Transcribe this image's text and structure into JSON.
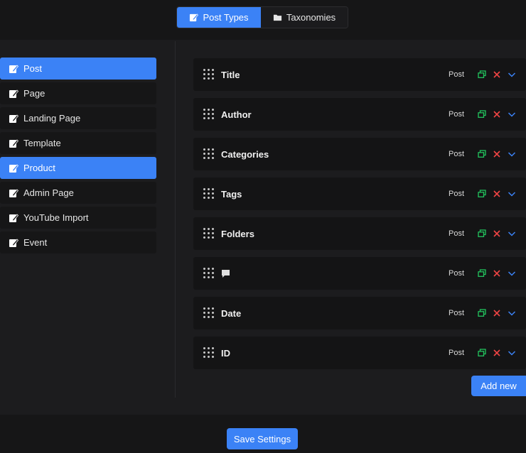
{
  "tabs": [
    {
      "label": "Post Types",
      "icon": "edit-icon",
      "active": true
    },
    {
      "label": "Taxonomies",
      "icon": "folder-icon",
      "active": false
    }
  ],
  "sidebar": {
    "items": [
      {
        "label": "Post",
        "active": true
      },
      {
        "label": "Page",
        "active": false
      },
      {
        "label": "Landing Page",
        "active": false
      },
      {
        "label": "Template",
        "active": false
      },
      {
        "label": "Product",
        "active": true
      },
      {
        "label": "Admin Page",
        "active": false
      },
      {
        "label": "YouTube Import",
        "active": false
      },
      {
        "label": "Event",
        "active": false
      }
    ]
  },
  "fields": [
    {
      "label": "Title",
      "type": "Post"
    },
    {
      "label": "Author",
      "type": "Post"
    },
    {
      "label": "Categories",
      "type": "Post"
    },
    {
      "label": "Tags",
      "type": "Post"
    },
    {
      "label": "Folders",
      "type": "Post"
    },
    {
      "label": "",
      "label_icon": "comment-icon",
      "type": "Post"
    },
    {
      "label": "Date",
      "type": "Post"
    },
    {
      "label": "ID",
      "type": "Post"
    }
  ],
  "buttons": {
    "add_new": "Add new",
    "save_settings": "Save Settings"
  },
  "colors": {
    "accent": "#3b82f6",
    "copy": "#22c55e",
    "delete": "#ef4444",
    "expand": "#3b82f6"
  }
}
